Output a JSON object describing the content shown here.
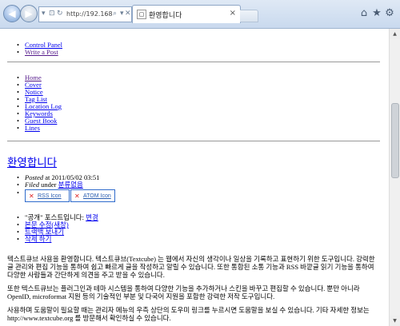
{
  "browser": {
    "address": "http://192.168.0...",
    "tab_title": "환영합니다",
    "icons": {
      "back": "back-arrow-icon",
      "forward": "forward-arrow-icon",
      "home": "home-icon",
      "favorites": "star-icon",
      "tools": "gear-icon"
    }
  },
  "top_links": [
    "Control Panel",
    "Write a Post"
  ],
  "nav_links": [
    "Home",
    "Cover",
    "Notice",
    "Tag List",
    "Location Log",
    "Keywords",
    "Guest Book",
    "Lines"
  ],
  "post": {
    "title": "환영합니다",
    "posted_label": "Posted",
    "posted_at": " at 2011/05/02 03:51",
    "filed_label": "Filed",
    "filed_under": " under ",
    "category": "분류없음",
    "feeds": [
      "RSS Icon",
      "ATOM Icon"
    ],
    "actions": {
      "line1_pre": "\"공개\" 포스트입니다: ",
      "line1_link": "변경",
      "edit": "본문 수정(새창)",
      "trackback": "트랙백 보내기",
      "delete": "삭제 하기"
    },
    "paragraphs": [
      "텍스트큐브 사용을 환영합니다. 텍스트큐브(Textcube) 는 웹에서 자신의 생각이나 일상을 기록하고 표현하기 위한 도구입니다. 강력한 글 관리와 편집 기능을 통하여 쉽고 빠르게 글을 작성하고 알릴 수 있습니다. 또한 통합된 소통 기능과 RSS 바깥글 읽기 기능을 통하여 다양한 사람들과 간단하게 의견을 주고 받을 수 있습니다.",
      "또한 텍스트큐브는 플러그인과 테마 시스템을 통하여 다양한 기능을 추가하거나 스킨을 바꾸고 편집할 수 있습니다. 뿐만 아니라 OpenID, microformat 지원 등의 기술적인 부분 및 다국어 지원을 포함한 강력한 저작 도구입니다.",
      "사용하며 도움말이 필요할 때는 관리자 메뉴의 우측 상단의 도우미 링크를 누르시면 도움말을 보실 수 있습니다. 기타 자세한 정보는 http://www.textcube.org 를 방문해서 확인하실 수 있습니다."
    ]
  }
}
